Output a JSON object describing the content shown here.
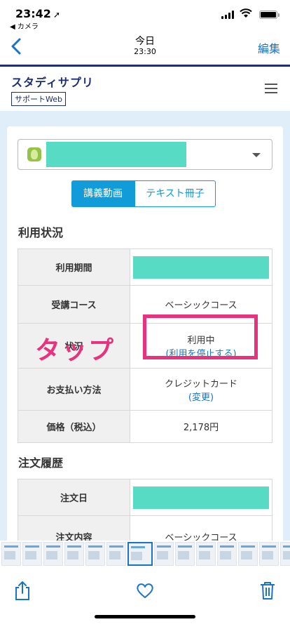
{
  "status_bar": {
    "time": "23:42",
    "location_glyph": "➚",
    "back_app": "◀ カメラ"
  },
  "photo_nav": {
    "title": "今日",
    "subtitle": "23:30",
    "edit_label": "編集"
  },
  "site_header": {
    "logo_main": "スタディサプリ",
    "logo_sub": "サポートWeb"
  },
  "account_selector": {
    "name_redacted": true
  },
  "tabs": [
    {
      "label": "講義動画",
      "active": true
    },
    {
      "label": "テキスト冊子",
      "active": false
    }
  ],
  "usage": {
    "title": "利用状況",
    "rows": {
      "period_label": "利用期間",
      "course_label": "受講コース",
      "course_value": "ベーシックコース",
      "status_label": "状況",
      "status_value": "利用中",
      "status_link": "(利用を停止する)",
      "payment_label": "お支払い方法",
      "payment_value": "クレジットカード",
      "payment_link": "(変更)",
      "price_label": "価格（税込）",
      "price_value": "2,178円"
    }
  },
  "orders": {
    "title": "注文履歴",
    "rows": {
      "date_label": "注文日",
      "content_label": "注文内容",
      "content_value": "ベーシックコース"
    }
  },
  "annotation": {
    "text": "タップ"
  },
  "colors": {
    "accent": "#119bd8",
    "annotation": "#e9327e",
    "redaction": "#58dbc5",
    "brand": "#1d2e73"
  }
}
